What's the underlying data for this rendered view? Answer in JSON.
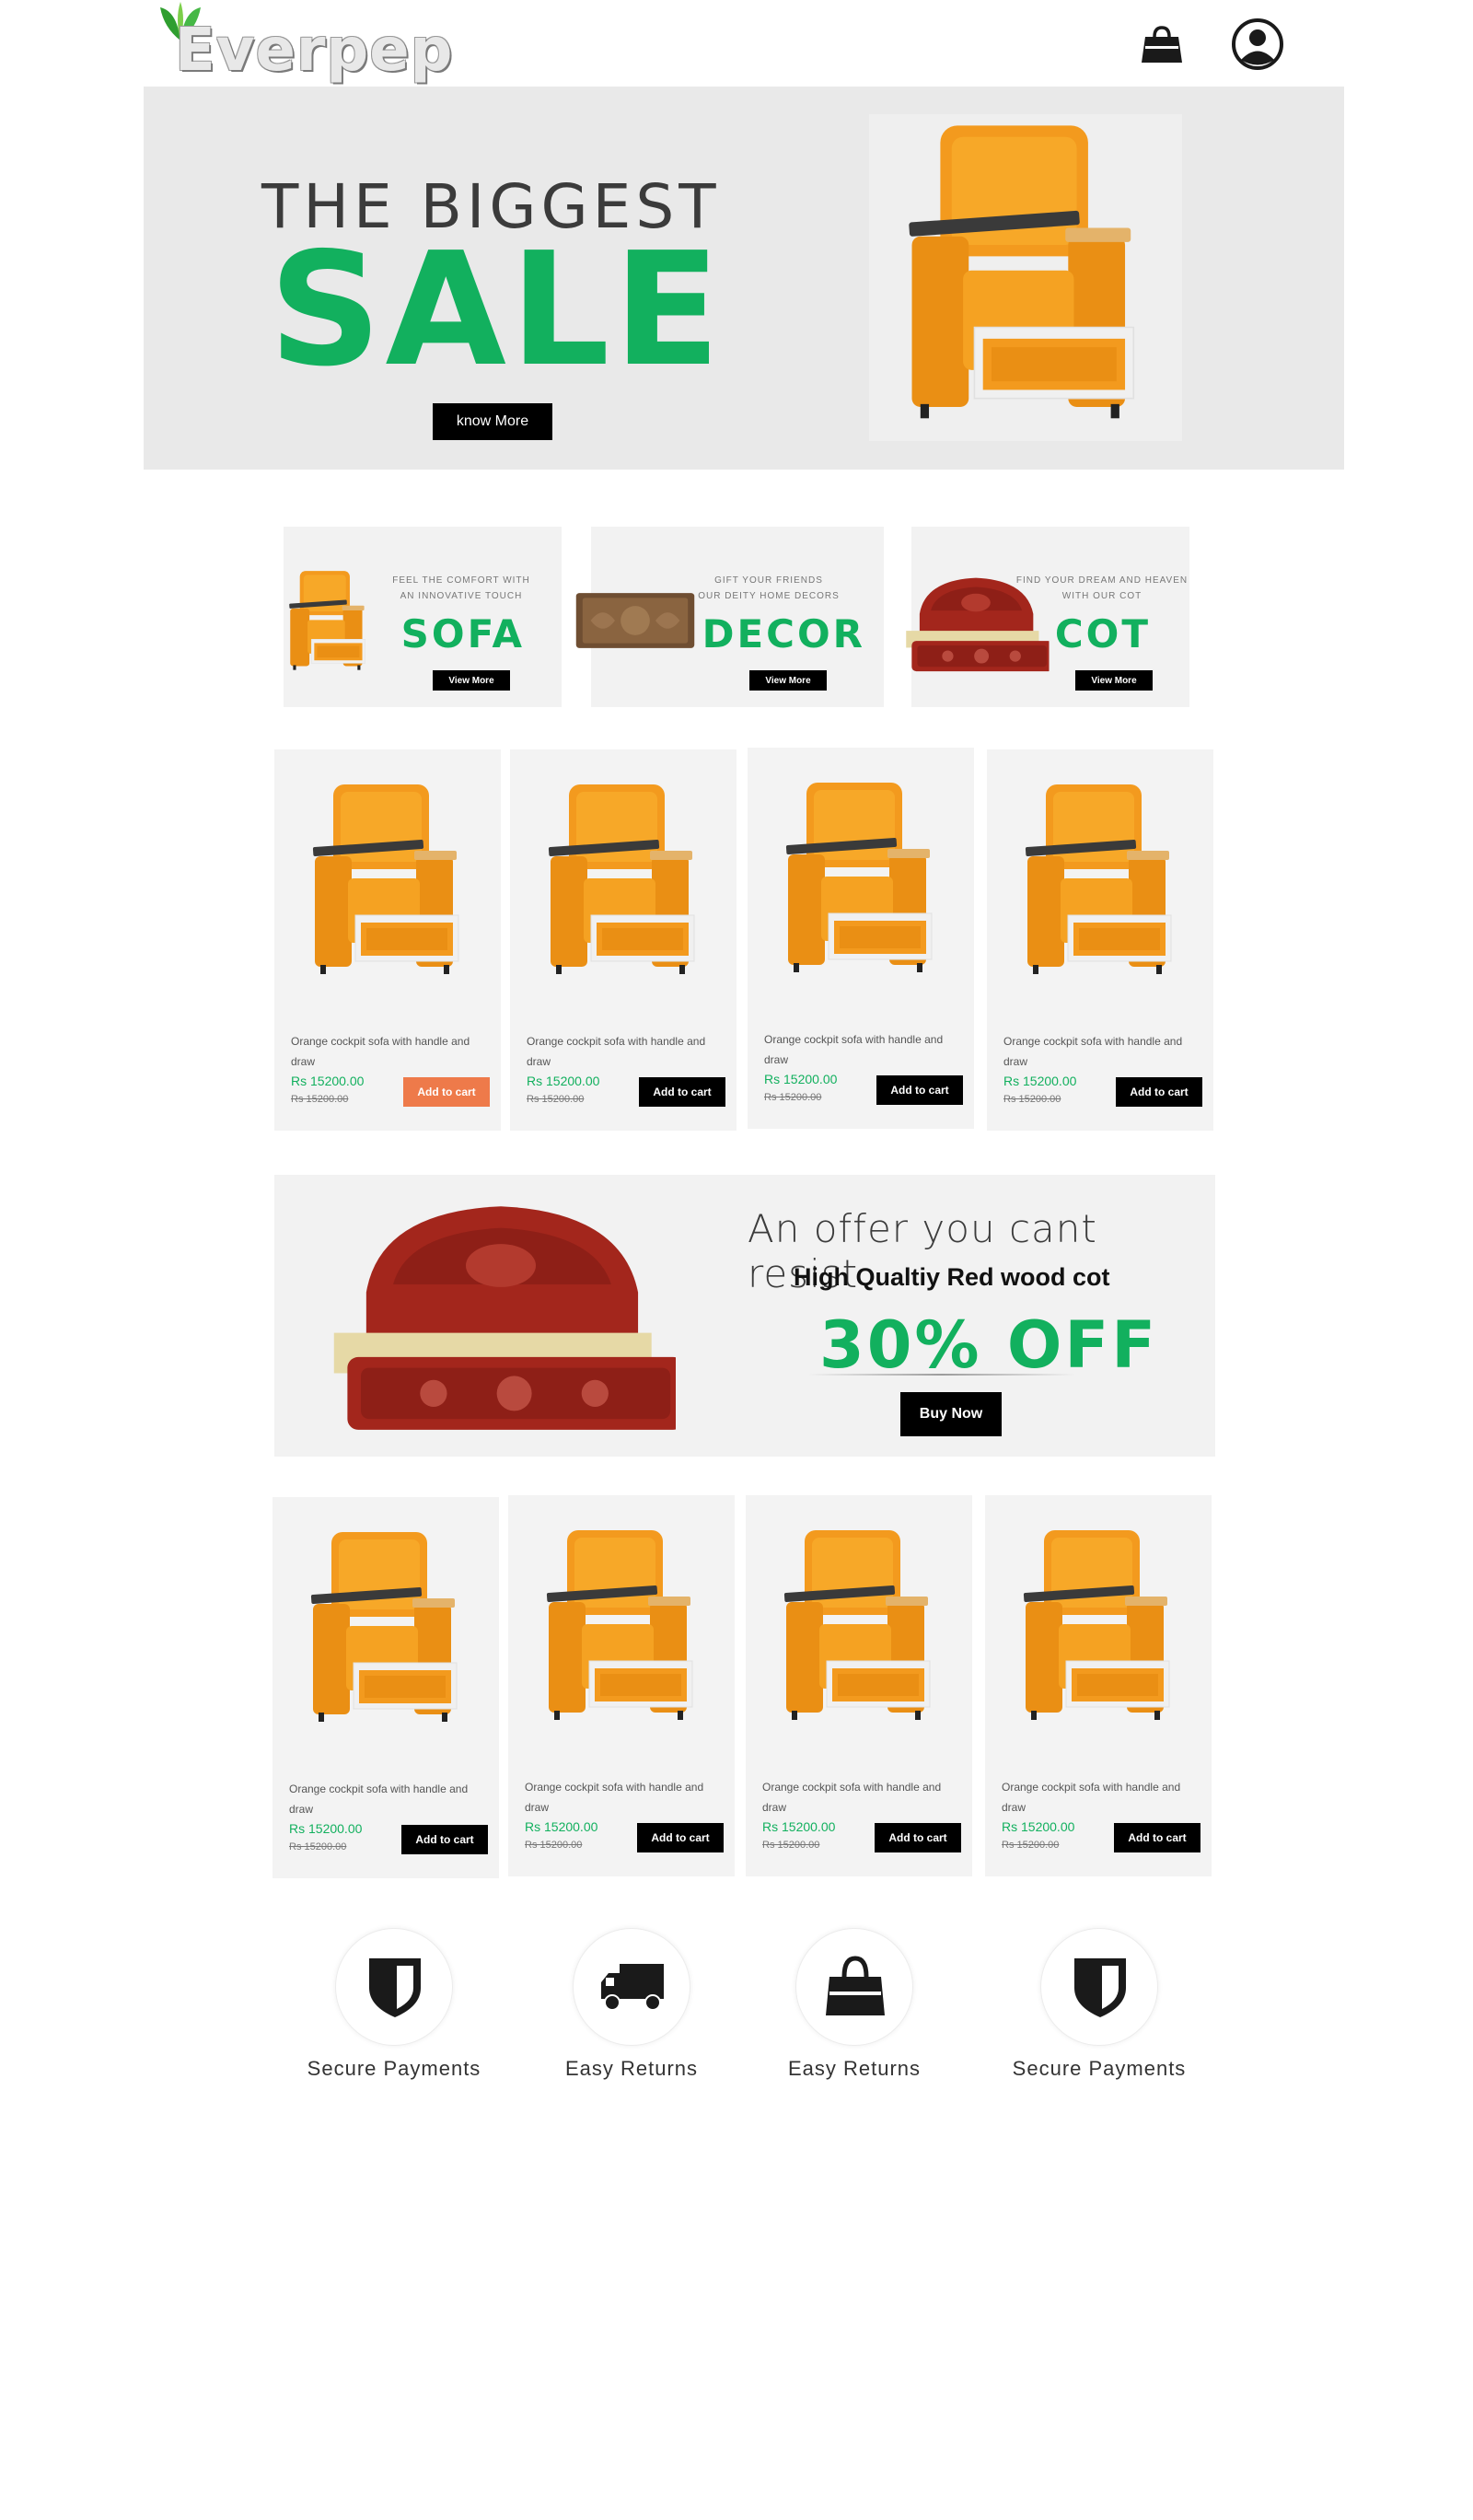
{
  "header": {
    "logo_text": "Everpep",
    "cart_icon": "shopping-bag-icon",
    "account_icon": "user-account-icon"
  },
  "hero": {
    "kicker": "THE BIGGEST",
    "title": "SALE",
    "button_label": "know More"
  },
  "categories": [
    {
      "tagline_line1": "FEEL THE COMFORT WITH",
      "tagline_line2": "AN INNOVATIVE TOUCH",
      "title": "SOFA",
      "button_label": "View More"
    },
    {
      "tagline_line1": "GIFT YOUR FRIENDS",
      "tagline_line2": "OUR DEITY HOME DECORS",
      "title": "DECOR",
      "button_label": "View More"
    },
    {
      "tagline_line1": "FIND YOUR DREAM AND HEAVEN",
      "tagline_line2": "WITH OUR COT",
      "title": "COT",
      "button_label": "View More"
    }
  ],
  "products_row1": [
    {
      "name": "Orange cockpit sofa with handle and draw",
      "price": "Rs 15200.00",
      "old_price": "Rs 15200.00",
      "button_label": "Add to cart"
    },
    {
      "name": "Orange cockpit sofa with handle and draw",
      "price": "Rs 15200.00",
      "old_price": "Rs 15200.00",
      "button_label": "Add to cart"
    },
    {
      "name": "Orange cockpit sofa with handle and draw",
      "price": "Rs 15200.00",
      "old_price": "Rs 15200.00",
      "button_label": "Add to cart"
    },
    {
      "name": "Orange cockpit sofa with handle and draw",
      "price": "Rs 15200.00",
      "old_price": "Rs 15200.00",
      "button_label": "Add to cart"
    }
  ],
  "offer": {
    "kicker": "An offer you cant resist",
    "subtitle": "High Qualtiy Red wood cot",
    "discount": "30% OFF",
    "button_label": "Buy Now"
  },
  "products_row2": [
    {
      "name": "Orange cockpit sofa with handle and draw",
      "price": "Rs 15200.00",
      "old_price": "Rs 15200.00",
      "button_label": "Add to cart"
    },
    {
      "name": "Orange cockpit sofa with handle and draw",
      "price": "Rs 15200.00",
      "old_price": "Rs 15200.00",
      "button_label": "Add to cart"
    },
    {
      "name": "Orange cockpit sofa with handle and draw",
      "price": "Rs 15200.00",
      "old_price": "Rs 15200.00",
      "button_label": "Add to cart"
    },
    {
      "name": "Orange cockpit sofa with handle and draw",
      "price": "Rs 15200.00",
      "old_price": "Rs 15200.00",
      "button_label": "Add to cart"
    }
  ],
  "features": [
    {
      "label": "Secure Payments",
      "icon": "shield-icon"
    },
    {
      "label": "Easy Returns",
      "icon": "truck-icon"
    },
    {
      "label": "Easy Returns",
      "icon": "shopping-bag-icon"
    },
    {
      "label": "Secure Payments",
      "icon": "shield-icon"
    }
  ],
  "colors": {
    "accent_green": "#12b05e",
    "hot_button": "#ee7a4a",
    "sofa_orange": "#f39a1e",
    "cot_red": "#a3261c"
  }
}
